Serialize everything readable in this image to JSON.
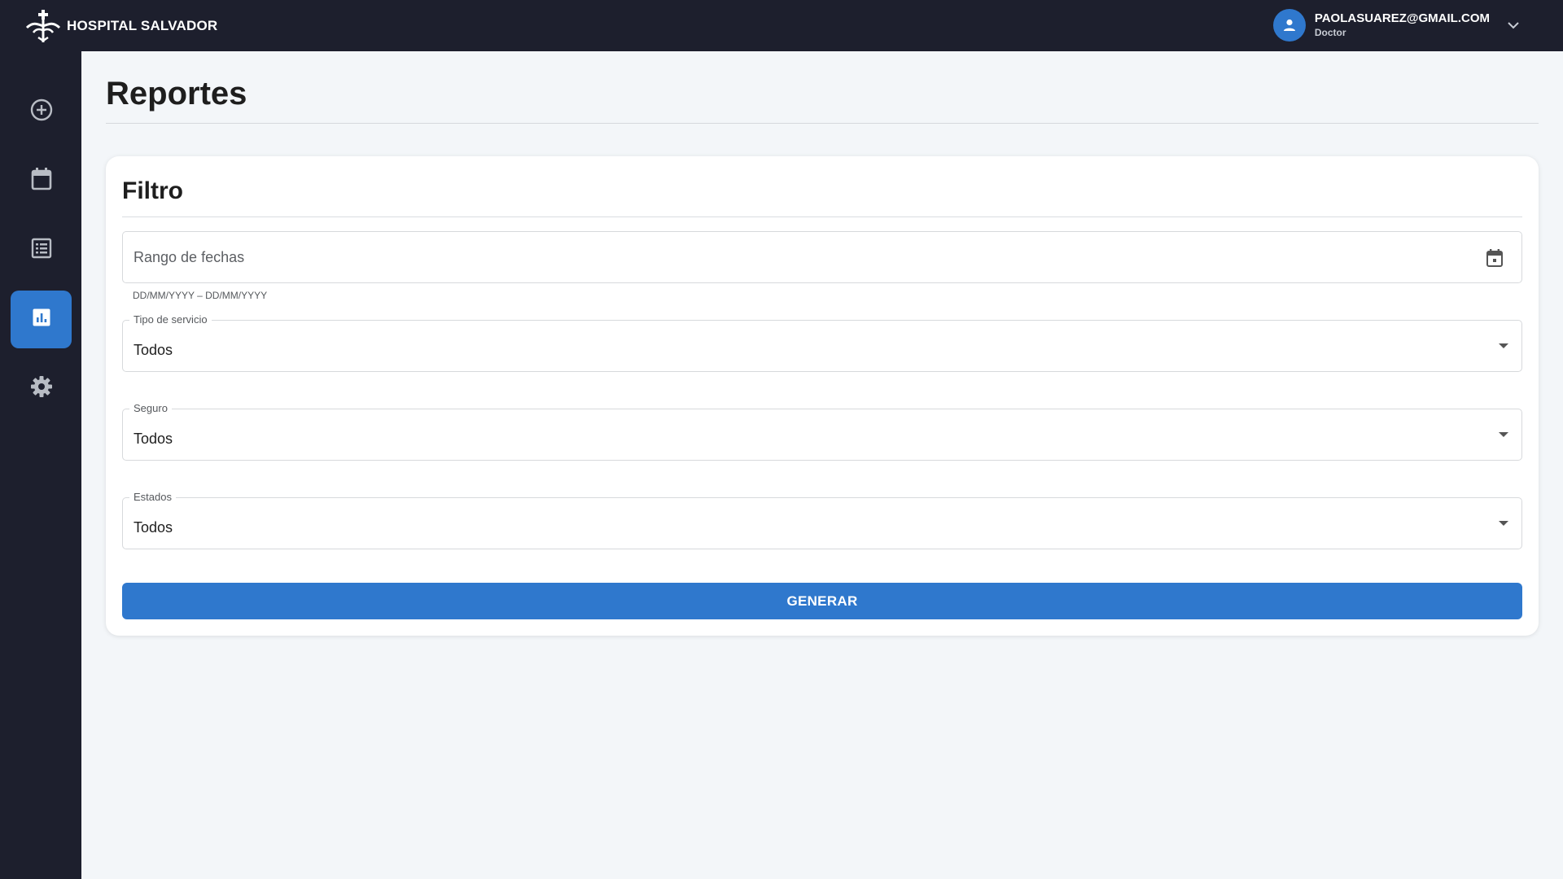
{
  "app": {
    "name": "HOSPITAL SALVADOR"
  },
  "user": {
    "email": "PAOLASUAREZ@GMAIL.COM",
    "role": "Doctor"
  },
  "sidebar": {
    "items": [
      {
        "icon": "add-circle-icon",
        "active": false
      },
      {
        "icon": "calendar-icon",
        "active": false
      },
      {
        "icon": "list-icon",
        "active": false
      },
      {
        "icon": "report-chart-icon",
        "active": true
      },
      {
        "icon": "gear-icon",
        "active": false
      }
    ]
  },
  "page": {
    "title": "Reportes"
  },
  "filter": {
    "title": "Filtro",
    "date_range": {
      "placeholder": "Rango de fechas",
      "helper": "DD/MM/YYYY – DD/MM/YYYY"
    },
    "service_type": {
      "label": "Tipo de servicio",
      "value": "Todos"
    },
    "insurance": {
      "label": "Seguro",
      "value": "Todos"
    },
    "status": {
      "label": "Estados",
      "value": "Todos"
    },
    "generate_label": "GENERAR"
  },
  "colors": {
    "topbar": "#1d1f2d",
    "accent": "#2f78cd",
    "background": "#f3f6f9"
  }
}
